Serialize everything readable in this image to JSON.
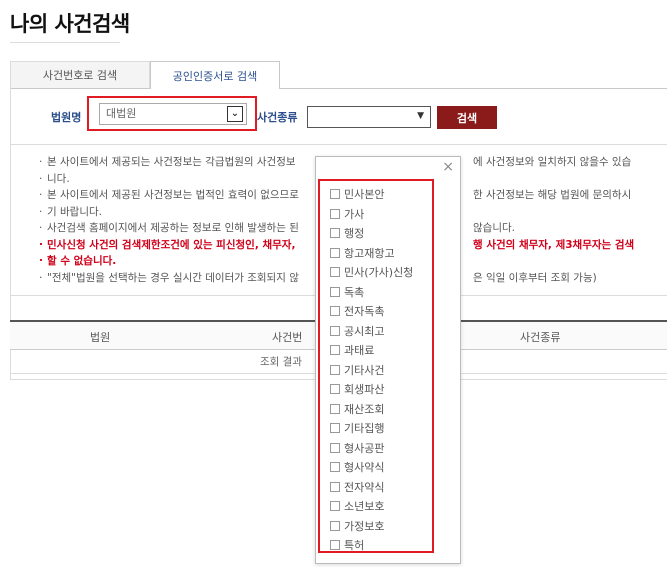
{
  "page_title": "나의 사건검색",
  "tabs": [
    {
      "label": "사건번호로 검색"
    },
    {
      "label": "공인인증서로 검색"
    }
  ],
  "search": {
    "court_label": "법원명",
    "court_value": "대법원",
    "court_arrow": "⌄",
    "case_type_label": "사건종류",
    "case_type_value": "",
    "case_type_arrow": "▼",
    "button_label": "검색"
  },
  "notices": [
    "본 사이트에서 제공되는 사건정보는 각급법원의 사건정보",
    "니다.",
    "본 사이트에서 제공된 사건정보는 법적인 효력이 없으므로",
    "기 바랍니다.",
    "사건검색 홈페이지에서 제공하는 정보로 인해 발생하는 된",
    "민사신청 사건의 검색제한조건에 있는 피신청인, 채무자,",
    "할 수 없습니다.",
    "\"전체\"법원을 선택하는 경우 실시간 데이터가 조회되지 않"
  ],
  "notice_right": [
    "에 사건정보와 일치하지 않을수 있습",
    "한 사건정보는 해당 법원에 문의하시",
    "않습니다.",
    "행 사건의 채무자, 제3채무자는 검색",
    "은 익일 이후부터 조회 가능)"
  ],
  "table": {
    "headers": [
      "법원",
      "사건번",
      "사건종류"
    ],
    "empty_text": "조회 결과"
  },
  "popup": {
    "close_label": "×",
    "options": [
      "민사본안",
      "가사",
      "행정",
      "항고재항고",
      "민사(가사)신청",
      "독촉",
      "전자독촉",
      "공시최고",
      "과태료",
      "기타사건",
      "회생파산",
      "재산조회",
      "기타집행",
      "형사공판",
      "형사약식",
      "전자약식",
      "소년보호",
      "가정보호",
      "특허"
    ]
  },
  "colors": {
    "accent": "#2b4f8c",
    "button": "#8b1a1a",
    "highlight": "#e01b24",
    "warning_text": "#d0001a"
  }
}
